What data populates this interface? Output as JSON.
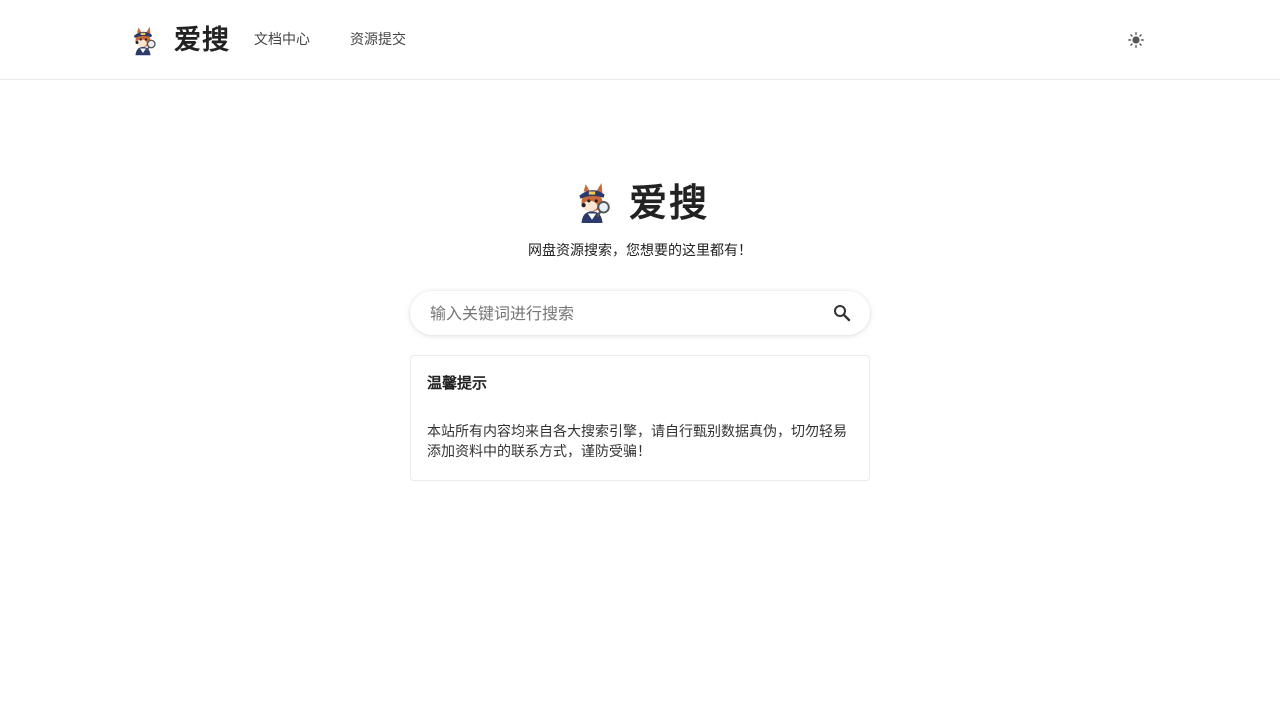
{
  "header": {
    "brand_name": "爱搜",
    "nav": [
      {
        "label": "文档中心"
      },
      {
        "label": "资源提交"
      }
    ],
    "theme_toggle_icon": "sun-icon"
  },
  "hero": {
    "brand_name": "爱搜",
    "tagline": "网盘资源搜索，您想要的这里都有！"
  },
  "search": {
    "placeholder": "输入关键词进行搜索",
    "value": "",
    "button_icon": "search-icon"
  },
  "notice": {
    "title": "温馨提示",
    "body": "本站所有内容均来自各大搜索引擎，请自行甄别数据真伪，切勿轻易添加资料中的联系方式，谨防受骗！"
  },
  "colors": {
    "text": "#222222",
    "border": "#e9e9e9",
    "background": "#ffffff",
    "mascot_hat": "#2c3a6b",
    "mascot_fur": "#c8693a"
  }
}
